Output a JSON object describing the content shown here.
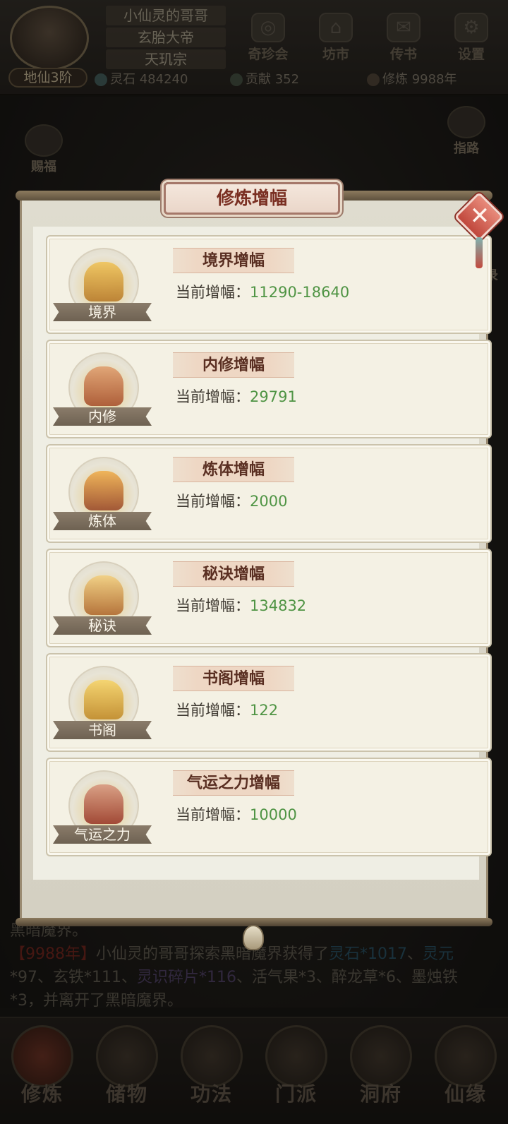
{
  "player": {
    "rank": "地仙3阶",
    "name": "小仙灵的哥哥",
    "title": "玄胎大帝",
    "sect": "天玑宗"
  },
  "top_menu": [
    {
      "label": "奇珍会",
      "icon": "treasure-icon"
    },
    {
      "label": "坊市",
      "icon": "market-icon"
    },
    {
      "label": "传书",
      "icon": "letter-icon"
    },
    {
      "label": "设置",
      "icon": "gear-icon"
    }
  ],
  "resources": [
    {
      "label": "灵石",
      "value": "484240",
      "icon": "spirit-stone-icon"
    },
    {
      "label": "贡献",
      "value": "352",
      "icon": "contribution-icon"
    },
    {
      "label": "修炼",
      "value": "9988年",
      "icon": "cultivation-icon"
    }
  ],
  "side_buttons": {
    "left": "赐福",
    "right": "指路",
    "right_partial": "录"
  },
  "log": {
    "line0": "黑暗魔界。",
    "year": "【9988年】",
    "text1": "小仙灵的哥哥探索黑暗魔界获得了",
    "loot1": "灵石*1017",
    "text2": "、",
    "loot2": "灵元",
    "line2a": "*97、玄铁*111、",
    "line2b": "灵识碎片*116",
    "line2c": "、活气果*3、醉龙草*6、墨烛铁",
    "line3": "*3，并离开了黑暗魔界。"
  },
  "bottom_nav": [
    {
      "label": "修炼",
      "icon": "cultivate-icon",
      "active": true
    },
    {
      "label": "储物",
      "icon": "storage-icon",
      "active": false
    },
    {
      "label": "功法",
      "icon": "technique-icon",
      "active": false
    },
    {
      "label": "门派",
      "icon": "sect-icon",
      "active": false
    },
    {
      "label": "洞府",
      "icon": "cave-icon",
      "active": false
    },
    {
      "label": "仙缘",
      "icon": "fate-icon",
      "active": false
    }
  ],
  "modal": {
    "title": "修炼增幅",
    "close_label": "✕",
    "amp_label": "当前增幅：",
    "cards": [
      {
        "emblem_label": "境界",
        "heading": "境界增幅",
        "value": "11290-18640",
        "icon": "realm-icon"
      },
      {
        "emblem_label": "内修",
        "heading": "内修增幅",
        "value": "29791",
        "icon": "inner-cultivation-icon"
      },
      {
        "emblem_label": "炼体",
        "heading": "炼体增幅",
        "value": "2000",
        "icon": "body-refining-icon"
      },
      {
        "emblem_label": "秘诀",
        "heading": "秘诀增幅",
        "value": "134832",
        "icon": "secret-art-icon"
      },
      {
        "emblem_label": "书阁",
        "heading": "书阁增幅",
        "value": "122",
        "icon": "library-icon"
      },
      {
        "emblem_label": "气运之力",
        "heading": "气运之力增幅",
        "value": "10000",
        "icon": "fortune-icon"
      }
    ]
  },
  "colors": {
    "value_green": "#4f9444",
    "title_red": "#7a2f22",
    "close_red": "#c0473c"
  }
}
